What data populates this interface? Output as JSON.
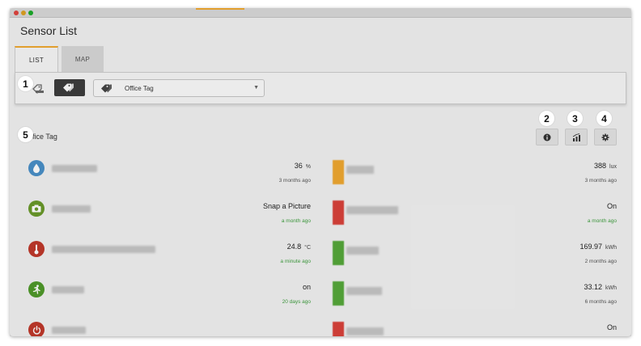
{
  "window": {
    "title": "Sensor List"
  },
  "tabs": [
    {
      "label": "LIST",
      "active": true
    },
    {
      "label": "MAP",
      "active": false
    }
  ],
  "filter": {
    "selected_tag": "Office Tag"
  },
  "badges": [
    "1",
    "2",
    "3",
    "4",
    "5"
  ],
  "section": {
    "title": "Office Tag",
    "title_visible": "fice Tag",
    "actions": [
      "info-icon",
      "chart-icon",
      "gear-icon"
    ]
  },
  "sensors_left": [
    {
      "icon": "water-drop-icon",
      "icon_color": "#4a90c8",
      "value": "36",
      "unit": "%",
      "time": "3 months ago",
      "time_color": "grey"
    },
    {
      "icon": "camera-icon",
      "icon_color": "#6a9a2a",
      "value": "Snap a Picture",
      "unit": "",
      "time": "a month ago",
      "time_color": "green"
    },
    {
      "icon": "thermometer-icon",
      "icon_color": "#c0392b",
      "value": "24.8",
      "unit": "°C",
      "time": "a minute ago",
      "time_color": "green"
    },
    {
      "icon": "running-person-icon",
      "icon_color": "#4f9a2a",
      "value": "on",
      "unit": "",
      "time": "20 days ago",
      "time_color": "green"
    },
    {
      "icon": "power-icon",
      "icon_color": "#c0392b",
      "value": "",
      "unit": "",
      "time": "",
      "time_color": "grey"
    }
  ],
  "sensors_right": [
    {
      "swatch": "#f0a830",
      "value": "388",
      "unit": "lux",
      "time": "3 months ago",
      "time_color": "grey"
    },
    {
      "swatch": "#d9413a",
      "value": "On",
      "unit": "",
      "time": "a month ago",
      "time_color": "green"
    },
    {
      "swatch": "#55a83a",
      "value": "169.97",
      "unit": "kWh",
      "time": "2 months ago",
      "time_color": "grey"
    },
    {
      "swatch": "#55a83a",
      "value": "33.12",
      "unit": "kWh",
      "time": "6 months ago",
      "time_color": "grey"
    },
    {
      "swatch": "#d9413a",
      "value": "On",
      "unit": "",
      "time": "",
      "time_color": "grey"
    }
  ],
  "colors": {
    "accent": "#f0a830",
    "green_time": "#3f9e3f",
    "dark_button": "#3d3d3d"
  }
}
